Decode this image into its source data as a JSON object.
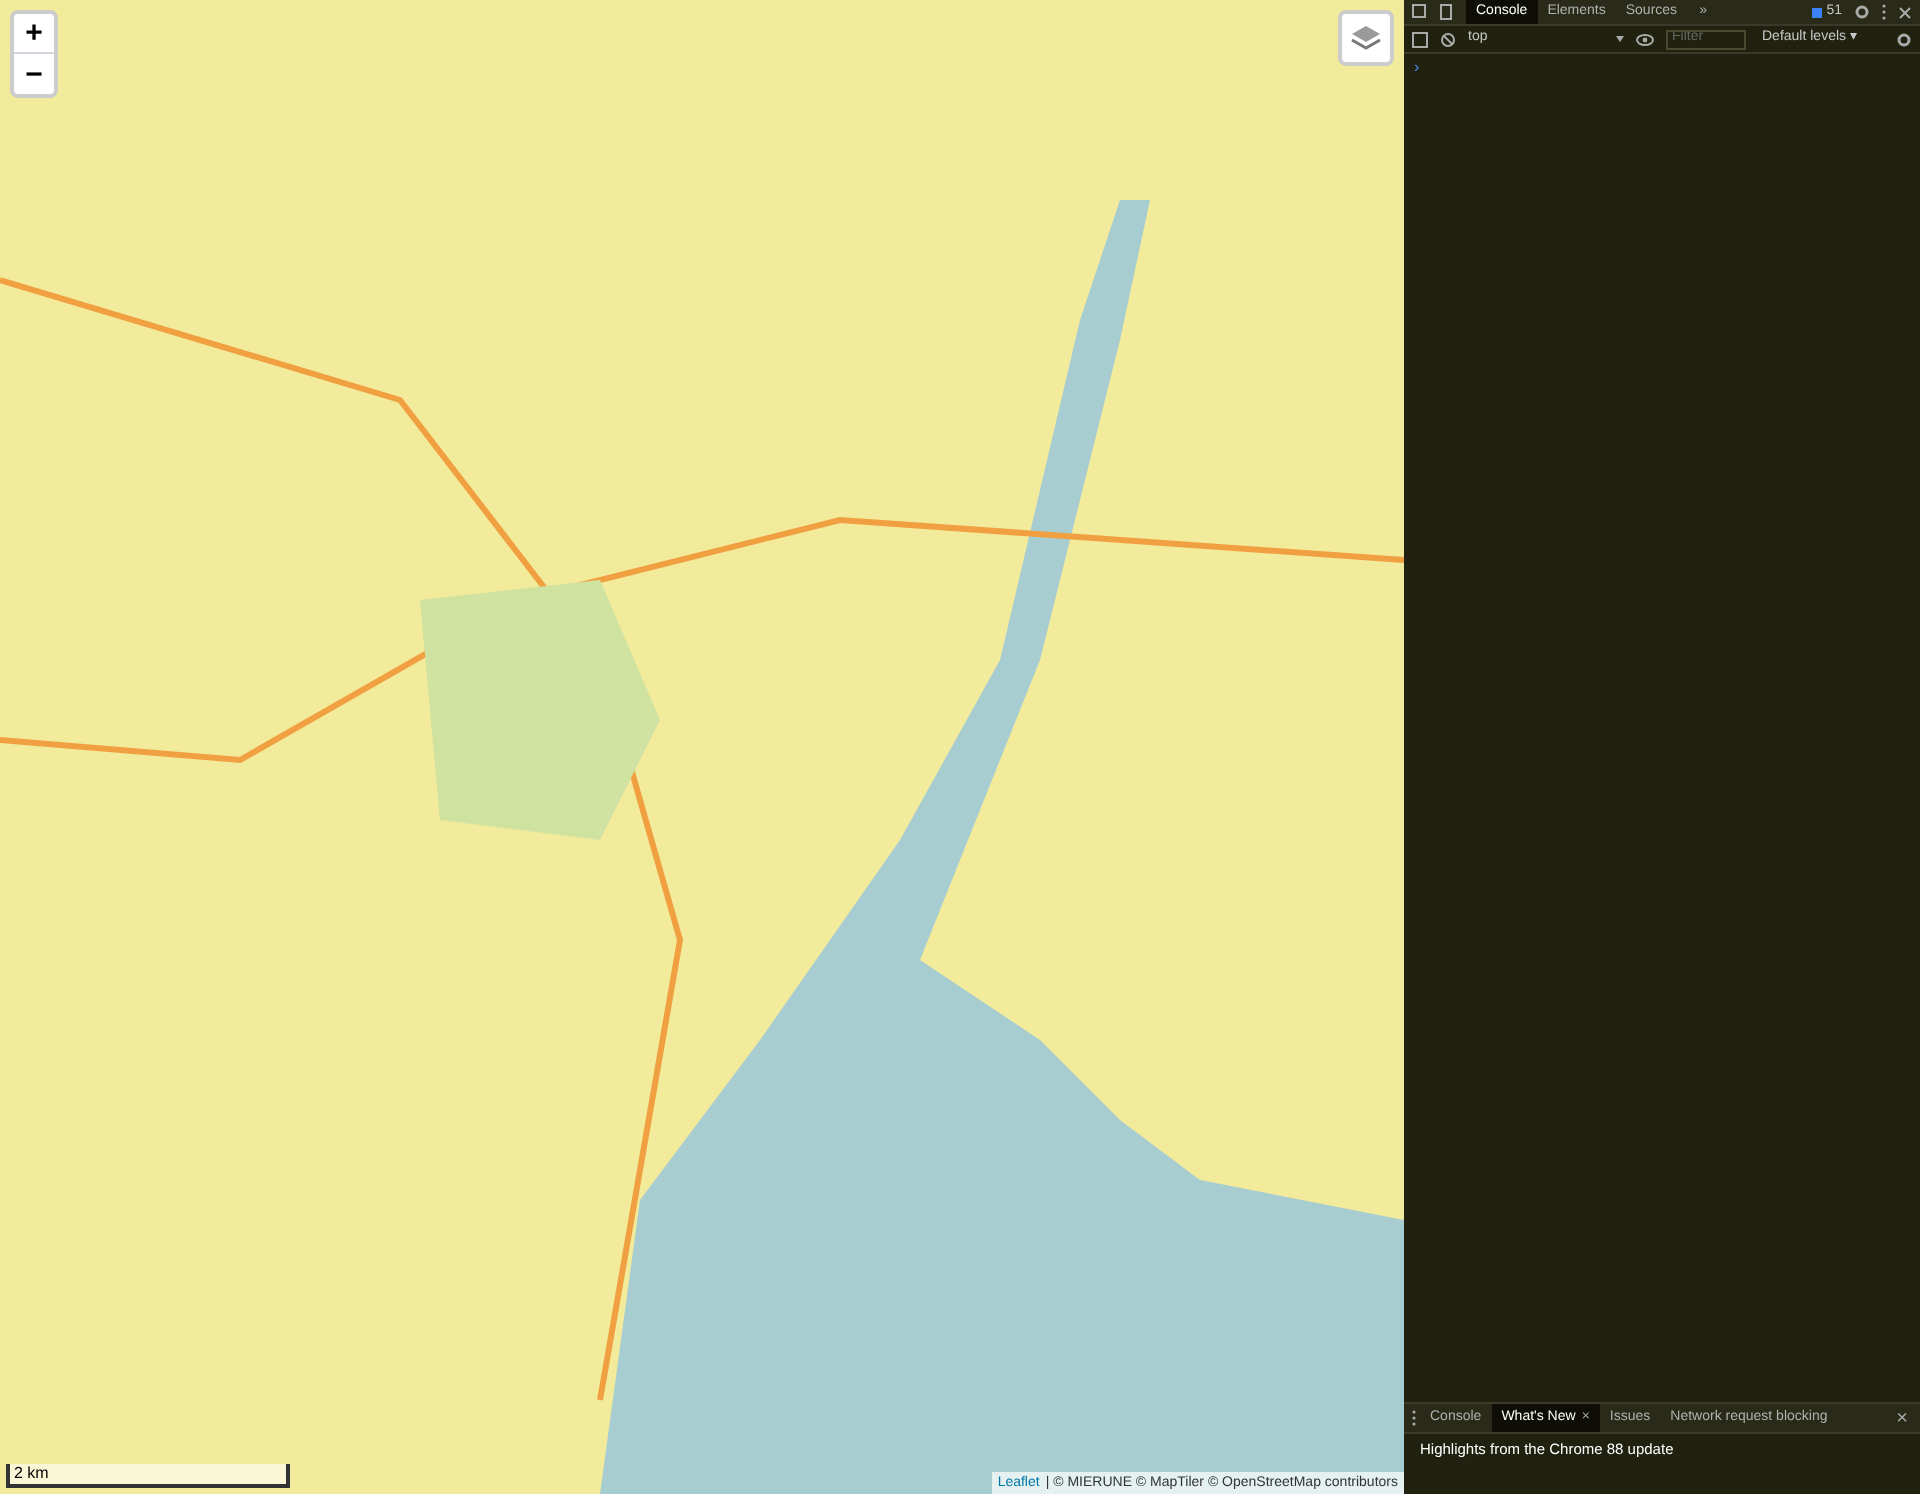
{
  "map": {
    "zoom_in": "+",
    "zoom_out": "−",
    "scale": "2 km",
    "attribution": [
      {
        "text": "Leaflet",
        "link": true
      },
      {
        "text": "| © MIERUNE © MapTiler © OpenStreetMap contributors",
        "link": false
      }
    ]
  },
  "devtools": {
    "tabs": [
      {
        "label": "Console",
        "selected": true
      },
      {
        "label": "Elements",
        "selected": false
      },
      {
        "label": "Sources",
        "selected": false
      }
    ],
    "more": "»",
    "issues_count": "51",
    "context": "top",
    "filter_placeholder": "Filter",
    "levels": "Default levels ▾",
    "prompt": "›",
    "drawer_tabs": [
      {
        "label": "Console",
        "selected": false,
        "closable": false
      },
      {
        "label": "What's New",
        "selected": true,
        "closable": true
      },
      {
        "label": "Issues",
        "selected": false,
        "closable": false
      },
      {
        "label": "Network request blocking",
        "selected": false,
        "closable": false
      }
    ],
    "drawer_close": "×",
    "close_tab": "×",
    "highlights": "Highlights from the Chrome 88 update"
  }
}
